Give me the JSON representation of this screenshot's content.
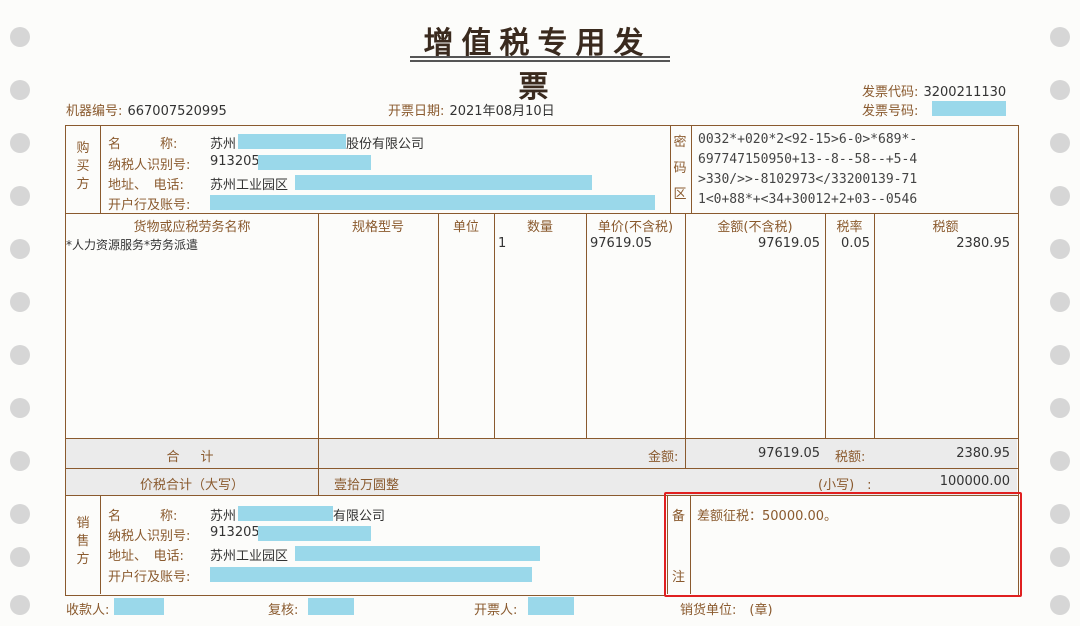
{
  "header": {
    "title": "增值税专用发票",
    "machine_no_label": "机器编号:",
    "machine_no": "667007520995",
    "issue_date_label": "开票日期:",
    "issue_date": "2021年08月10日",
    "invoice_code_label": "发票代码:",
    "invoice_code": "3200211130",
    "invoice_number_label": "发票号码:"
  },
  "buyer": {
    "side_label": [
      "购",
      "买",
      "方"
    ],
    "name_label": "名　　　称:",
    "name_prefix": "苏州",
    "name_suffix": "股份有限公司",
    "tax_id_label": "纳税人识别号:",
    "tax_id_prefix": "913205",
    "address_label": "地址、　电话:",
    "address_prefix": "苏州工业园区",
    "bank_label": "开户行及账号:"
  },
  "cipher": {
    "side_label": [
      "密",
      "码",
      "区"
    ],
    "lines": [
      "0032*+020*2<92-15>6-0>*689*-",
      "697747150950+13--8--58--+5-4",
      ">330/>>-8102973</33200139-71",
      "1<0+88*+<34+30012+2+03--0546"
    ]
  },
  "items": {
    "headers": [
      "货物或应税劳务名称",
      "规格型号",
      "单位",
      "数量",
      "单价(不含税)",
      "金额(不含税)",
      "税率",
      "税额"
    ],
    "rows": [
      {
        "name": "*人力资源服务*劳务派遣",
        "spec": "",
        "unit": "",
        "qty": "1",
        "price": "97619.05",
        "amount": "97619.05",
        "rate": "0.05",
        "tax": "2380.95"
      }
    ]
  },
  "totals": {
    "label": "合　计",
    "amount_label": "金额:",
    "amount": "97619.05",
    "tax_label": "税额:",
    "tax": "2380.95",
    "grand_label": "价税合计（大写）",
    "grand_words": "壹拾万圆整",
    "small_label": "(小写)　:",
    "grand_number": "100000.00"
  },
  "seller": {
    "side_label": [
      "销",
      "售",
      "方"
    ],
    "name_label": "名　　　称:",
    "name_prefix": "苏州",
    "name_suffix": "有限公司",
    "tax_id_label": "纳税人识别号:",
    "tax_id_prefix": "913205",
    "address_label": "地址、　电话:",
    "address_prefix": "苏州工业园区",
    "bank_label": "开户行及账号:"
  },
  "remarks": {
    "side_label": [
      "备",
      "注"
    ],
    "text": "差额征税：50000.00。"
  },
  "footer": {
    "payee_label": "收款人:",
    "reviewer_label": "复核:",
    "issuer_label": "开票人:",
    "seller_seal_label": "销货单位:　(章)"
  },
  "colors": {
    "ink": "#8a5a2e",
    "redaction": "#9ad8ea",
    "highlight_box": "#e02020"
  }
}
